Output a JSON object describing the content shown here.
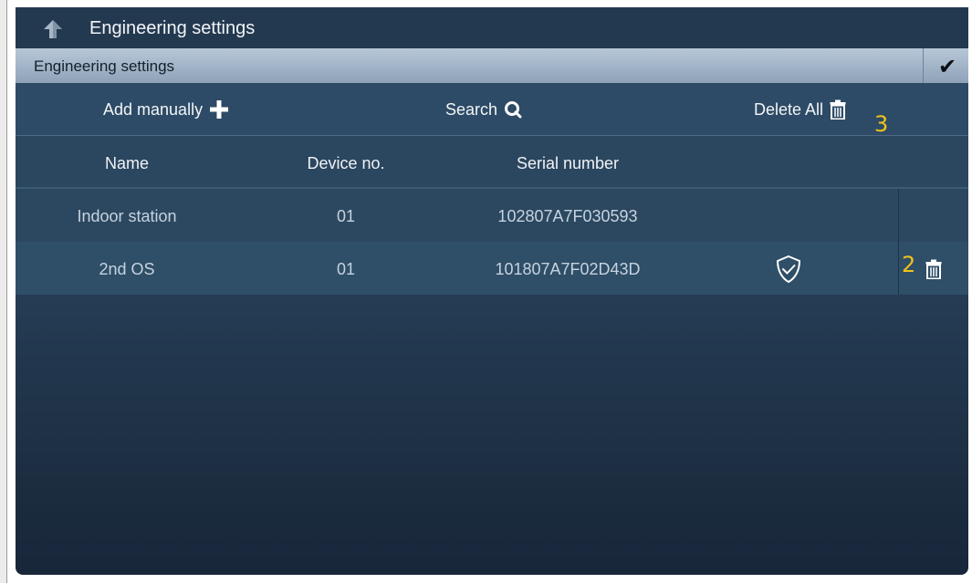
{
  "titlebar": {
    "title": "Engineering settings"
  },
  "subbar": {
    "title": "Engineering settings",
    "confirm_glyph": "✔"
  },
  "toolbar": {
    "add_label": "Add manually",
    "search_label": "Search",
    "delete_all_label": "Delete All",
    "delete_all_annotation": "3"
  },
  "table": {
    "headers": [
      "Name",
      "Device no.",
      "Serial number"
    ],
    "rows": [
      {
        "name": "Indoor station",
        "device_no": "01",
        "serial": "102807A7F030593"
      },
      {
        "name": "2nd OS",
        "device_no": "01",
        "serial": "101807A7F02D43D",
        "annotation": "2"
      }
    ]
  },
  "icons": {
    "back": "back-arrow-icon",
    "add": "plus-icon",
    "search": "search-icon",
    "delete": "trash-icon",
    "verified": "shield-check-icon",
    "confirm": "check-icon"
  },
  "colors": {
    "annotation": "#f0c21a",
    "header_bar": "#b7c7d8",
    "background": "#2a4560"
  }
}
